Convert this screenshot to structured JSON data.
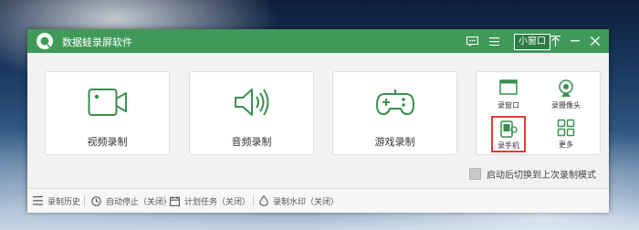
{
  "app": {
    "title": "数据蛙录屏软件"
  },
  "titlebar": {
    "mini_window_label": "小窗口",
    "buttons": [
      "chat-icon",
      "menu-icon",
      "pin-icon",
      "minimize-icon",
      "close-icon"
    ]
  },
  "modes": [
    {
      "label": "视频录制",
      "icon": "video-camera-icon"
    },
    {
      "label": "音频录制",
      "icon": "speaker-icon"
    },
    {
      "label": "游戏录制",
      "icon": "gamepad-icon"
    }
  ],
  "quick": [
    {
      "label": "录窗口",
      "icon": "window-icon"
    },
    {
      "label": "录摄像头",
      "icon": "webcam-icon"
    },
    {
      "label": "录手机",
      "icon": "phone-icon",
      "highlighted": true
    },
    {
      "label": "更多",
      "icon": "grid-icon"
    }
  ],
  "options": {
    "auto_switch_label": "启动后切换到上次录制模式",
    "auto_switch_checked": false
  },
  "statusbar": [
    {
      "label": "录制历史",
      "icon": "list-icon"
    },
    {
      "label": "自动停止（关闭）",
      "icon": "clock-icon"
    },
    {
      "label": "计划任务（关闭）",
      "icon": "calendar-icon"
    },
    {
      "label": "录制水印（关闭）",
      "icon": "watermark-icon"
    }
  ],
  "colors": {
    "brand_green": "#3f9a58",
    "icon_green": "#3a8f4f",
    "highlight_red": "#e53935"
  }
}
